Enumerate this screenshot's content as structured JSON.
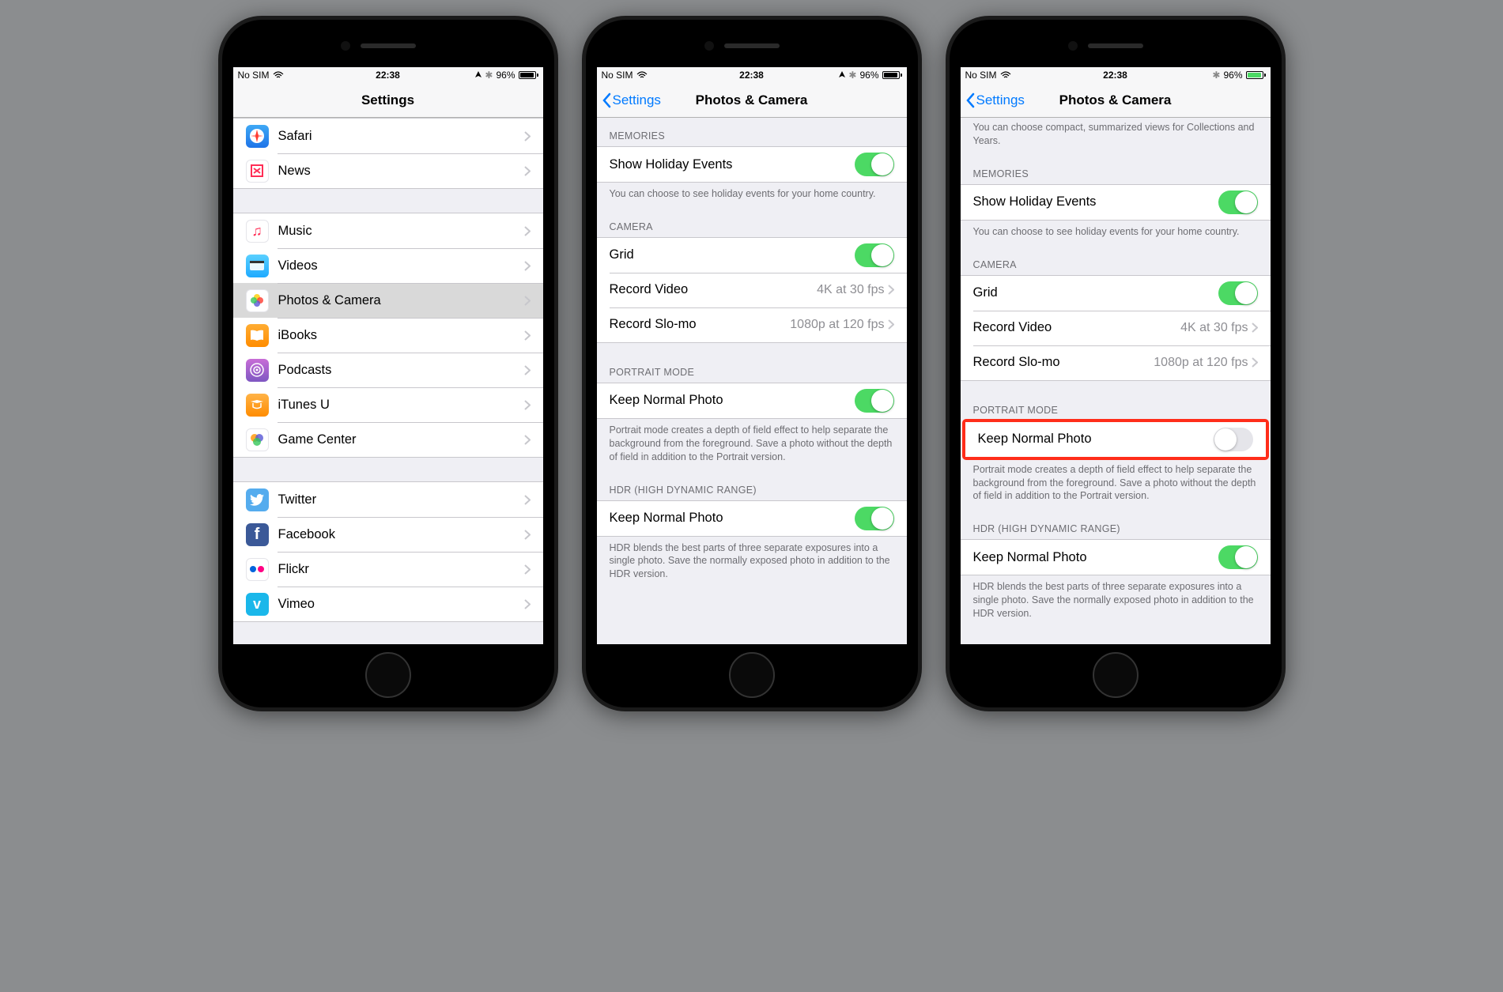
{
  "status": {
    "carrier": "No SIM",
    "time": "22:38",
    "battery_pct": "96%"
  },
  "phone1": {
    "nav_title": "Settings",
    "rows_group1": [
      {
        "label": "Safari",
        "icon": "safari"
      },
      {
        "label": "News",
        "icon": "news"
      }
    ],
    "rows_group2": [
      {
        "label": "Music",
        "icon": "music"
      },
      {
        "label": "Videos",
        "icon": "videos"
      },
      {
        "label": "Photos & Camera",
        "icon": "photos",
        "highlighted": true
      },
      {
        "label": "iBooks",
        "icon": "ibooks"
      },
      {
        "label": "Podcasts",
        "icon": "podcasts"
      },
      {
        "label": "iTunes U",
        "icon": "itunesu"
      },
      {
        "label": "Game Center",
        "icon": "game"
      }
    ],
    "rows_group3": [
      {
        "label": "Twitter",
        "icon": "twitter"
      },
      {
        "label": "Facebook",
        "icon": "facebook"
      },
      {
        "label": "Flickr",
        "icon": "flickr"
      },
      {
        "label": "Vimeo",
        "icon": "vimeo"
      }
    ]
  },
  "phone2": {
    "nav_back": "Settings",
    "nav_title": "Photos & Camera",
    "memories_header": "MEMORIES",
    "memories_row": "Show Holiday Events",
    "memories_footer": "You can choose to see holiday events for your home country.",
    "camera_header": "CAMERA",
    "grid_label": "Grid",
    "record_video_label": "Record Video",
    "record_video_value": "4K at 30 fps",
    "record_slomo_label": "Record Slo-mo",
    "record_slomo_value": "1080p at 120 fps",
    "portrait_header": "PORTRAIT MODE",
    "portrait_row": "Keep Normal Photo",
    "portrait_footer": "Portrait mode creates a depth of field effect to help separate the background from the foreground. Save a photo without the depth of field in addition to the Portrait version.",
    "hdr_header": "HDR (HIGH DYNAMIC RANGE)",
    "hdr_row": "Keep Normal Photo",
    "hdr_footer": "HDR blends the best parts of three separate exposures into a single photo. Save the normally exposed photo in addition to the HDR version."
  },
  "phone3": {
    "nav_back": "Settings",
    "nav_title": "Photos & Camera",
    "top_footer": "You can choose compact, summarized views for Collections and Years.",
    "memories_header": "MEMORIES",
    "memories_row": "Show Holiday Events",
    "memories_footer": "You can choose to see holiday events for your home country.",
    "camera_header": "CAMERA",
    "grid_label": "Grid",
    "record_video_label": "Record Video",
    "record_video_value": "4K at 30 fps",
    "record_slomo_label": "Record Slo-mo",
    "record_slomo_value": "1080p at 120 fps",
    "portrait_header": "PORTRAIT MODE",
    "portrait_row": "Keep Normal Photo",
    "portrait_footer": "Portrait mode creates a depth of field effect to help separate the background from the foreground. Save a photo without the depth of field in addition to the Portrait version.",
    "hdr_header": "HDR (HIGH DYNAMIC RANGE)",
    "hdr_row": "Keep Normal Photo",
    "hdr_footer": "HDR blends the best parts of three separate exposures into a single photo. Save the normally exposed photo in addition to the HDR version."
  }
}
